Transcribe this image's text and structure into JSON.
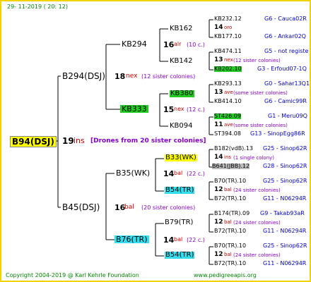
{
  "header_date": "29- 11-2019 ( 20: 12)",
  "footer_left": "Copyright 2004-2019 @ Karl Kehrle Foundation",
  "footer_right": "www.pedigreeapis.org",
  "root": {
    "name": "B94(DSJ)",
    "year": "19",
    "suffix": "ins",
    "note": "[Drones from 20 sister colonies]"
  },
  "gen1": [
    {
      "name": "B294(DSJ)",
      "year": "18",
      "suffix": "nex",
      "note": "(12 sister colonies)"
    },
    {
      "name": "B45(DSJ)",
      "year": "16",
      "suffix": "bal",
      "note": "(20 sister colonies)"
    }
  ],
  "gen2": [
    {
      "name": "KB294",
      "year": "16",
      "suffix": "alr",
      "note": "(10 c.)"
    },
    {
      "name": "KB333",
      "year": "15",
      "suffix": "nex",
      "note": "(12 c.)"
    },
    {
      "name": "B35(WK)",
      "year": "14",
      "suffix": "bal",
      "note": "(22 c.)"
    },
    {
      "name": "B76(TR)",
      "year": "14",
      "suffix": "bal",
      "note": "(22 c.)"
    }
  ],
  "gen3": [
    {
      "name": "KB162",
      "year": "14",
      "suffix": "oro",
      "note": ""
    },
    {
      "name": "KB142",
      "year": "13",
      "suffix": "nex",
      "note": "(12 sister colonies)"
    },
    {
      "name": "KB380",
      "year": "13",
      "suffix": "ave",
      "note": "(some sister colonies)"
    },
    {
      "name": "KB094",
      "year": "11",
      "suffix": "ave",
      "note": "(some sister colonies)"
    },
    {
      "name": "B33(WK)",
      "year": "14",
      "suffix": "ins",
      "note": "(1 single colony)"
    },
    {
      "name": "B54(TR)",
      "year": "12",
      "suffix": "bal",
      "note": "(24 sister colonies)"
    },
    {
      "name": "B79(TR)",
      "year": "12",
      "suffix": "bal",
      "note": "(24 sister colonies)"
    },
    {
      "name": "B54(TR)",
      "year": "12",
      "suffix": "bal",
      "note": "(24 sister colonies)"
    }
  ],
  "gen4": [
    {
      "name": "KB232.12",
      "ref": "G6 - Cauca02R"
    },
    {
      "name": "KB177.10",
      "ref": "G6 - Ankar02Q"
    },
    {
      "name": "KB474.11",
      "ref": "G5 - not registe"
    },
    {
      "name": "KB202.10",
      "ref": "G3 - Erfoud07-1Q"
    },
    {
      "name": "KB293.13",
      "ref": "G0 - Sahar13Q1"
    },
    {
      "name": "KB414.10",
      "ref": "G6 - Camic99R"
    },
    {
      "name": "ST426.09",
      "ref": "G1 - Meru09Q"
    },
    {
      "name": "ST394.08",
      "ref": "G13 - SinopEgg86R"
    },
    {
      "name": "B182(vdB).13",
      "ref": "G25 - Sinop62R"
    },
    {
      "name": "B641(JBB).12",
      "ref": "G28 - Sinop62R"
    },
    {
      "name": "B70(TR).10",
      "ref": "G25 - Sinop62R"
    },
    {
      "name": "B72(TR).10",
      "ref": "G11 - N06294R"
    },
    {
      "name": "B174(TR).09",
      "ref": "G9 - Takab93aR"
    },
    {
      "name": "B72(TR).10",
      "ref": "G11 - N06294R"
    },
    {
      "name": "B70(TR).10",
      "ref": "G25 - Sinop62R"
    },
    {
      "name": "B72(TR).10",
      "ref": "G11 - N06294R"
    }
  ]
}
